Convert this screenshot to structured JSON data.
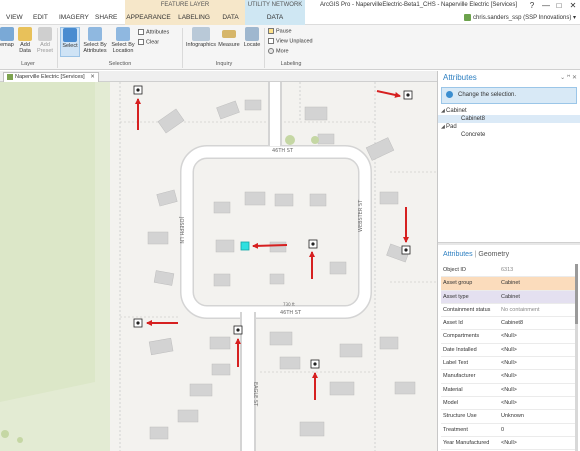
{
  "titlebar": {
    "feature_layer": "FEATURE LAYER",
    "utility_network": "UTILITY NETWORK",
    "app_title": "ArcGIS Pro - NapervilleElectric-Beta1_CHS - Naperville Electric [Services]",
    "help": "?",
    "minimize": "—",
    "maximize": "□",
    "close": "✕"
  },
  "tabs": {
    "view": "VIEW",
    "edit": "EDIT",
    "imagery": "IMAGERY",
    "share": "SHARE",
    "appearance": "APPEARANCE",
    "labeling": "LABELING",
    "data": "DATA",
    "data2": "DATA"
  },
  "user": "chris.sanders_ssp (SSP Innovations) ▾",
  "ribbon": {
    "basemap": "emap",
    "add_data": "Add Data",
    "add_preset": "Add Preset",
    "select": "Select",
    "select_by_attributes": "Select By Attributes",
    "select_by_location": "Select By Location",
    "attributes": "Attributes",
    "clear": "Clear",
    "infographics": "Infographics",
    "measure": "Measure",
    "locate": "Locate",
    "pause": "Pause",
    "view_unplaced": "View Unplaced",
    "more": "More",
    "group_layer": "Layer",
    "group_selection": "Selection",
    "group_inquiry": "Inquiry",
    "group_labeling": "Labeling"
  },
  "map_view": {
    "tab_label": "Naperville Electric [Services]",
    "close": "✕",
    "streets": {
      "s1": "46TH ST",
      "s2": "JOSEPH LN",
      "s3": "WEBSTER ST",
      "s4": "46TH ST",
      "s5": "EAGLE ST",
      "s6": "730 ft"
    }
  },
  "attributes_pane": {
    "title": "Attributes",
    "pin": "⌄ ꟸ ✕",
    "change_selection": "Change the selection.",
    "tree": [
      {
        "label": "Cabinet",
        "level": 1,
        "expanded": true
      },
      {
        "label": "Cabinet8",
        "level": 2,
        "selected": true
      },
      {
        "label": "Pad",
        "level": 1,
        "expanded": true
      },
      {
        "label": "Concrete",
        "level": 2,
        "selected": false
      }
    ],
    "tab_attributes": "Attributes",
    "tab_geometry": "Geometry",
    "rows": [
      {
        "key": "Object ID",
        "value": "6313"
      },
      {
        "key": "Asset group",
        "value": "Cabinet"
      },
      {
        "key": "Asset type",
        "value": "Cabinet"
      },
      {
        "key": "Containment status",
        "value": "No containment"
      },
      {
        "key": "Asset Id",
        "value": "Cabinet8"
      },
      {
        "key": "Compartments",
        "value": "<Null>"
      },
      {
        "key": "Date Installed",
        "value": "<Null>"
      },
      {
        "key": "Label Text",
        "value": "<Null>"
      },
      {
        "key": "Manufacturer",
        "value": "<Null>"
      },
      {
        "key": "Material",
        "value": "<Null>"
      },
      {
        "key": "Model",
        "value": "<Null>"
      },
      {
        "key": "Structure Use",
        "value": "Unknown"
      },
      {
        "key": "Treatment",
        "value": "0"
      },
      {
        "key": "Year Manufactured",
        "value": "<Null>"
      }
    ]
  },
  "colors": {
    "accent": "#2d7fc1",
    "arrow": "#d62020",
    "feature_tab": "#f6e7c9",
    "utility_tab": "#cfe7f3",
    "selected_feature": "#2ee0e0",
    "asset_group_bg": "#fbdcbc",
    "asset_type_bg": "#e4e0f0"
  }
}
